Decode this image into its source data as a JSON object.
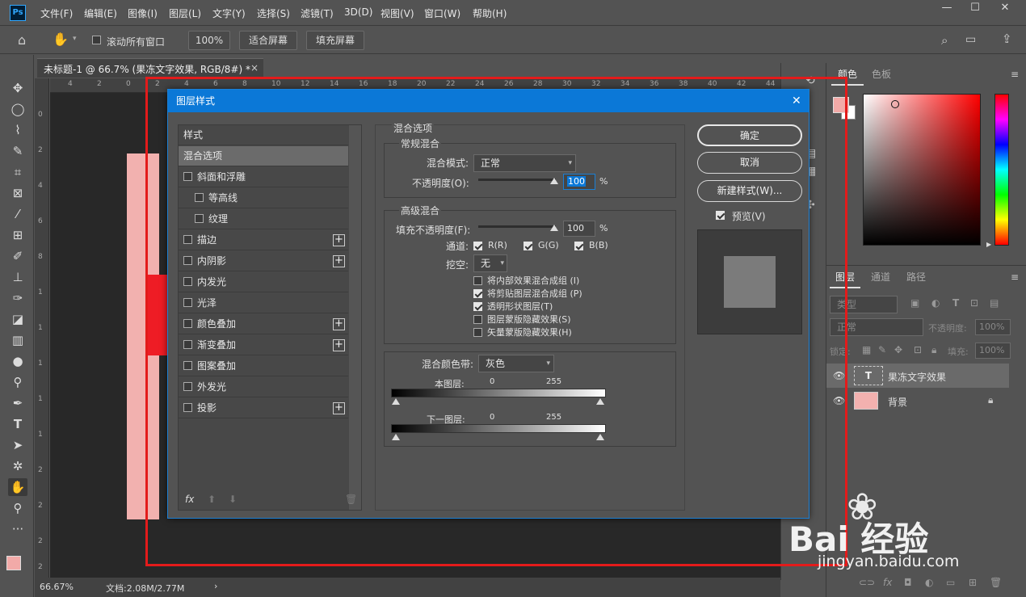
{
  "app": {
    "logo": "Ps"
  },
  "menubar": {
    "items": [
      "文件(F)",
      "编辑(E)",
      "图像(I)",
      "图层(L)",
      "文字(Y)",
      "选择(S)",
      "滤镜(T)",
      "3D(D)",
      "视图(V)",
      "窗口(W)",
      "帮助(H)"
    ],
    "minimize": "—",
    "maximize": "☐",
    "close": "✕"
  },
  "options": {
    "scroll_all_label": "滚动所有窗口",
    "zoom_value": "100%",
    "fit_screen": "适合屏幕",
    "fill_screen": "填充屏幕"
  },
  "document": {
    "tab_title": "未标题-1 @ 66.7% (果冻文字效果, RGB/8#) *",
    "tab_close": "×",
    "ruler_h": [
      "4",
      "2",
      "0",
      "2",
      "4",
      "6",
      "8",
      "10",
      "12",
      "14",
      "16",
      "18",
      "20",
      "22",
      "24",
      "26",
      "28",
      "30",
      "32",
      "34",
      "36",
      "38",
      "40",
      "42",
      "44"
    ],
    "ruler_v": [
      "0",
      "2",
      "4",
      "6",
      "8",
      "1",
      "1",
      "1",
      "1",
      "1",
      "2",
      "2",
      "2",
      "2"
    ]
  },
  "statusbar": {
    "zoom": "66.67%",
    "doc_info": "文档:2.08M/2.77M",
    "arrow": "›"
  },
  "dialog": {
    "title": "图层样式",
    "close": "✕",
    "styles_header": "样式",
    "style_items": [
      {
        "label": "混合选项",
        "checkbox": false,
        "checked": false,
        "plus": false,
        "selected": true,
        "indent": false
      },
      {
        "label": "斜面和浮雕",
        "checkbox": true,
        "checked": false,
        "plus": false,
        "selected": false,
        "indent": false
      },
      {
        "label": "等高线",
        "checkbox": true,
        "checked": false,
        "plus": false,
        "selected": false,
        "indent": true
      },
      {
        "label": "纹理",
        "checkbox": true,
        "checked": false,
        "plus": false,
        "selected": false,
        "indent": true
      },
      {
        "label": "描边",
        "checkbox": true,
        "checked": false,
        "plus": true,
        "selected": false,
        "indent": false
      },
      {
        "label": "内阴影",
        "checkbox": true,
        "checked": false,
        "plus": true,
        "selected": false,
        "indent": false
      },
      {
        "label": "内发光",
        "checkbox": true,
        "checked": false,
        "plus": false,
        "selected": false,
        "indent": false
      },
      {
        "label": "光泽",
        "checkbox": true,
        "checked": false,
        "plus": false,
        "selected": false,
        "indent": false
      },
      {
        "label": "颜色叠加",
        "checkbox": true,
        "checked": false,
        "plus": true,
        "selected": false,
        "indent": false
      },
      {
        "label": "渐变叠加",
        "checkbox": true,
        "checked": false,
        "plus": true,
        "selected": false,
        "indent": false
      },
      {
        "label": "图案叠加",
        "checkbox": true,
        "checked": false,
        "plus": false,
        "selected": false,
        "indent": false
      },
      {
        "label": "外发光",
        "checkbox": true,
        "checked": false,
        "plus": false,
        "selected": false,
        "indent": false
      },
      {
        "label": "投影",
        "checkbox": true,
        "checked": false,
        "plus": true,
        "selected": false,
        "indent": false
      }
    ],
    "fx_label": "fx",
    "blend": {
      "section_title": "混合选项",
      "general_title": "常规混合",
      "blend_mode_label": "混合模式:",
      "blend_mode_value": "正常",
      "opacity_label": "不透明度(O):",
      "opacity_value": "100",
      "percent": "%",
      "advanced_title": "高级混合",
      "fill_opacity_label": "填充不透明度(F):",
      "fill_opacity_value": "100",
      "channels_label": "通道:",
      "channel_r": "R(R)",
      "channel_g": "G(G)",
      "channel_b": "B(B)",
      "knockout_label": "挖空:",
      "knockout_value": "无",
      "options": [
        {
          "label": "将内部效果混合成组 (I)",
          "checked": false
        },
        {
          "label": "将剪贴图层混合成组 (P)",
          "checked": true
        },
        {
          "label": "透明形状图层(T)",
          "checked": true
        },
        {
          "label": "图层蒙版隐藏效果(S)",
          "checked": false
        },
        {
          "label": "矢量蒙版隐藏效果(H)",
          "checked": false
        }
      ],
      "blend_if_label": "混合颜色带:",
      "blend_if_value": "灰色",
      "this_layer_label": "本图层:",
      "under_layer_label": "下一图层:",
      "range_min": "0",
      "range_max": "255"
    },
    "buttons": {
      "ok": "确定",
      "cancel": "取消",
      "new_style": "新建样式(W)...",
      "preview": "预览(V)"
    }
  },
  "color_panel": {
    "tab_color": "颜色",
    "tab_swatches": "色板",
    "fg_color": "#f2aaa8",
    "bg_color": "#ffffff"
  },
  "layers_panel": {
    "tab_layers": "图层",
    "tab_channels": "通道",
    "tab_paths": "路径",
    "filter_label": "类型",
    "blend_mode": "正常",
    "opacity_label": "不透明度:",
    "opacity_value": "100%",
    "lock_label": "锁定:",
    "fill_label": "填充:",
    "fill_value": "100%",
    "layers": [
      {
        "name": "果冻文字效果",
        "type": "text",
        "thumb_glyph": "T",
        "selected": true
      },
      {
        "name": "背景",
        "type": "background",
        "thumb_color": "#f2b1af",
        "selected": false
      }
    ]
  },
  "watermark": {
    "brand": "Bai 经验",
    "url": "jingyan.baidu.com"
  }
}
